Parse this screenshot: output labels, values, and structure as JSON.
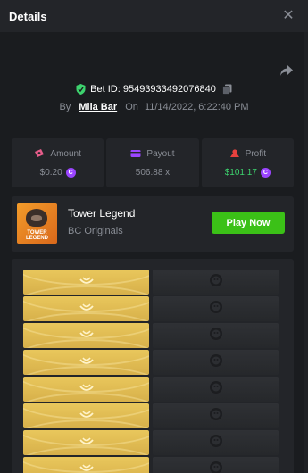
{
  "header": {
    "title": "Details",
    "close_glyph": "✕"
  },
  "icons": {
    "share": "share-icon",
    "verified": "shield-check-icon",
    "copy": "copy-icon"
  },
  "bet": {
    "id_label": "Bet ID: 95493933492076840",
    "by": "By",
    "user": "Mila Bar",
    "on": "On",
    "datetime": "11/14/2022, 6:22:40 PM"
  },
  "stats": {
    "amount": {
      "label": "Amount",
      "value": "$0.20"
    },
    "payout": {
      "label": "Payout",
      "value": "506.88 x"
    },
    "profit": {
      "label": "Profit",
      "value": "$101.17"
    }
  },
  "game": {
    "thumb_text": "TOWER LEGEND",
    "name": "Tower Legend",
    "provider": "BC Originals",
    "play_label": "Play Now"
  },
  "coin_glyph": "C",
  "colors": {
    "accent_green": "#3bc117",
    "profit_green": "#3dd36e",
    "coin_purple": "#9b45ff",
    "gold_tile": "#e2bf55",
    "dark_tile": "#2b2d31"
  },
  "board": {
    "rows": [
      [
        "gold",
        "dark"
      ],
      [
        "gold",
        "dark"
      ],
      [
        "gold",
        "dark"
      ],
      [
        "gold",
        "dark"
      ],
      [
        "gold",
        "dark"
      ],
      [
        "gold",
        "dark"
      ],
      [
        "gold",
        "dark"
      ],
      [
        "gold",
        "dark"
      ]
    ]
  }
}
